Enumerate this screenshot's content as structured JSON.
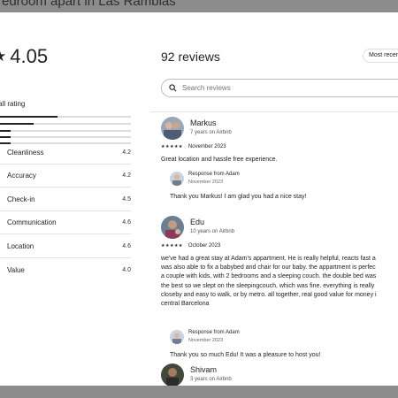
{
  "backdrop": {
    "title": "edroom apart in Las Ramblas"
  },
  "summary": {
    "star_icon": "star-icon",
    "rating": "4.05",
    "overall_label": "erall rating",
    "distribution": [
      {
        "fill": 0.44
      },
      {
        "fill": 0.26
      },
      {
        "fill": 0.08
      },
      {
        "fill": 0.08
      },
      {
        "fill": 0.08
      }
    ],
    "categories": [
      {
        "label": "Cleanliness",
        "value": "4.2"
      },
      {
        "label": "Accuracy",
        "value": "4.2"
      },
      {
        "label": "Check-in",
        "value": "4.5"
      },
      {
        "label": "Communication",
        "value": "4.6"
      },
      {
        "label": "Location",
        "value": "4.6"
      },
      {
        "label": "Value",
        "value": "4.0"
      }
    ]
  },
  "reviews_panel": {
    "count_title": "92 reviews",
    "sort_label": "Most recen",
    "search_placeholder": "Search reviews",
    "reviews": [
      {
        "name": "Markus",
        "meta": "7 years on Airbnb",
        "stars": "★★★★★",
        "date": "November 2023",
        "text": "Great location and hassle free experience.",
        "response": {
          "title": "Response from Adam",
          "date": "November 2023",
          "text": "Thank you Markus! I am glad you had a nice stay!"
        }
      },
      {
        "name": "Edu",
        "meta": "10 years on Airbnb",
        "stars": "★★★★★",
        "date": "October 2023",
        "text": "we've had a great stay at Adam's appartment. He is really helpful, reacts fast a\nwas also able to fix a babybed and chair for our baby. the appartment is perfec\na couple with kids, with 2 bedrooms and a sleeping couch. the double bed was\nthe best so we slept on the sleepingcouch, which was fine. everything is really\ncloseby and easy to walk, or by metro. all together, real good value for money i\ncentral Barcelona",
        "response": {
          "title": "Response from Adam",
          "date": "November 2023",
          "text": "Thank you so much Edu! It was a pleasure to host you!"
        }
      },
      {
        "name": "Shivam",
        "meta": "3 years on Airbnb"
      }
    ]
  },
  "colors": {
    "accent": "#222222",
    "backdrop": "#8a8a8a"
  }
}
